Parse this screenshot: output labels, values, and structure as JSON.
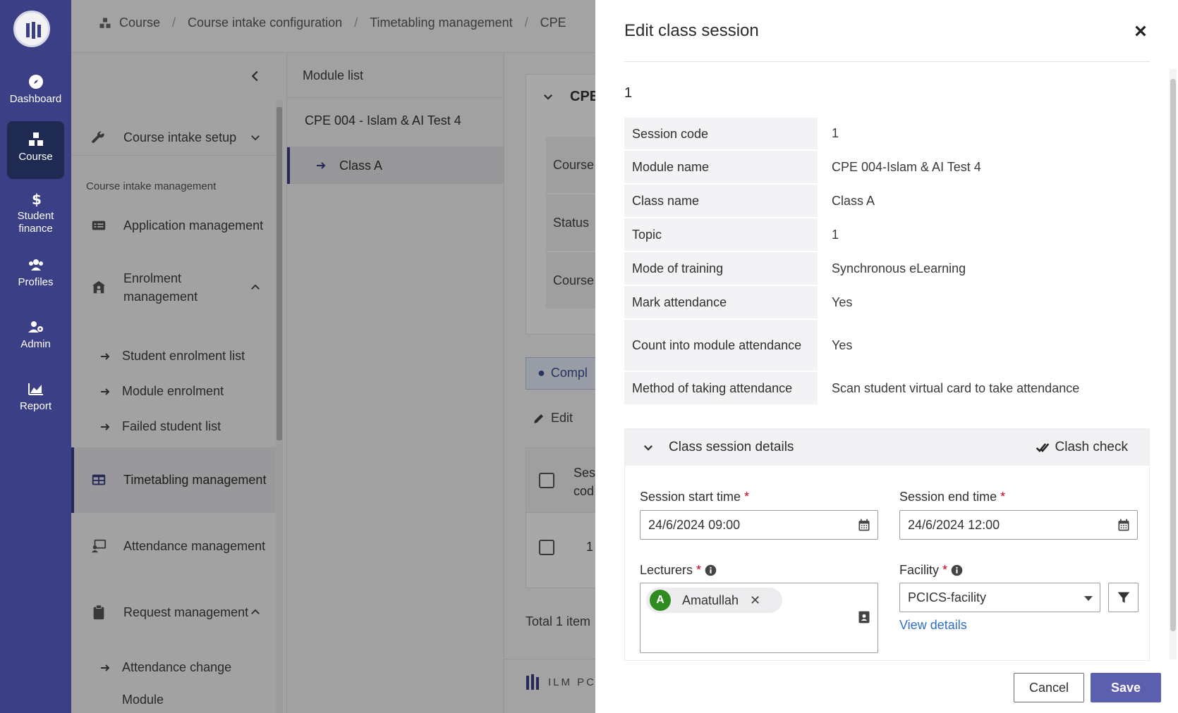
{
  "rail": {
    "items": [
      {
        "label": "Dashboard",
        "icon": "compass-icon"
      },
      {
        "label": "Course",
        "icon": "cubes-icon",
        "active": true
      },
      {
        "label": "Student finance",
        "icon": "dollar-icon"
      },
      {
        "label": "Profiles",
        "icon": "users-icon"
      },
      {
        "label": "Admin",
        "icon": "user-gear-icon"
      },
      {
        "label": "Report",
        "icon": "chart-area-icon"
      }
    ]
  },
  "breadcrumb": [
    "Course",
    "Course intake configuration",
    "Timetabling management",
    "CPE"
  ],
  "sidebar": {
    "course_intake_setup": "Course intake setup",
    "section_label": "Course intake management",
    "application_management": "Application management",
    "enrolment_management": "Enrolment management",
    "enrolment_sub": [
      "Student enrolment list",
      "Module enrolment",
      "Failed student list"
    ],
    "timetabling_management": "Timetabling management",
    "attendance_management": "Attendance management",
    "request_management": "Request management",
    "request_sub": [
      "Attendance change",
      "Module"
    ]
  },
  "module_list": {
    "header": "Module list",
    "module": "CPE 004 - Islam & AI Test 4",
    "class": "Class A"
  },
  "main": {
    "card_title": "CPE",
    "field_labels": [
      "Course",
      "Status",
      "Course"
    ],
    "comp_button": "Compl",
    "edit_label": "Edit",
    "col_header": "Ses cod",
    "row_value": "1",
    "total": "Total 1 item",
    "footer_logo": "ILM PC"
  },
  "drawer": {
    "title": "Edit class session",
    "session_heading": "1",
    "details": [
      {
        "key": "Session code",
        "value": "1"
      },
      {
        "key": "Module name",
        "value": "CPE 004-Islam & AI Test 4"
      },
      {
        "key": "Class name",
        "value": "Class A"
      },
      {
        "key": "Topic",
        "value": "1"
      },
      {
        "key": "Mode of training",
        "value": "Synchronous eLearning"
      },
      {
        "key": "Mark attendance",
        "value": "Yes"
      },
      {
        "key": "Count into module attendance",
        "value": "Yes"
      },
      {
        "key": "Method of taking attendance",
        "value": "Scan student virtual card to take attendance"
      }
    ],
    "panel_title": "Class session details",
    "clash_check": "Clash check",
    "start_label": "Session start time",
    "start_value": "24/6/2024 09:00",
    "end_label": "Session end time",
    "end_value": "24/6/2024 12:00",
    "lecturers_label": "Lecturers",
    "lecturer_chip": "Amatullah",
    "lecturer_initial": "A",
    "facility_label": "Facility",
    "facility_value": "PCICS-facility",
    "view_details": "View details",
    "required_mark": "*",
    "cancel": "Cancel",
    "save": "Save"
  },
  "colors": {
    "rail": "#3b3f86",
    "accent": "#5c5fae",
    "link": "#2f6fc6",
    "required": "#d0021b",
    "avatar": "#2f8a1f"
  }
}
